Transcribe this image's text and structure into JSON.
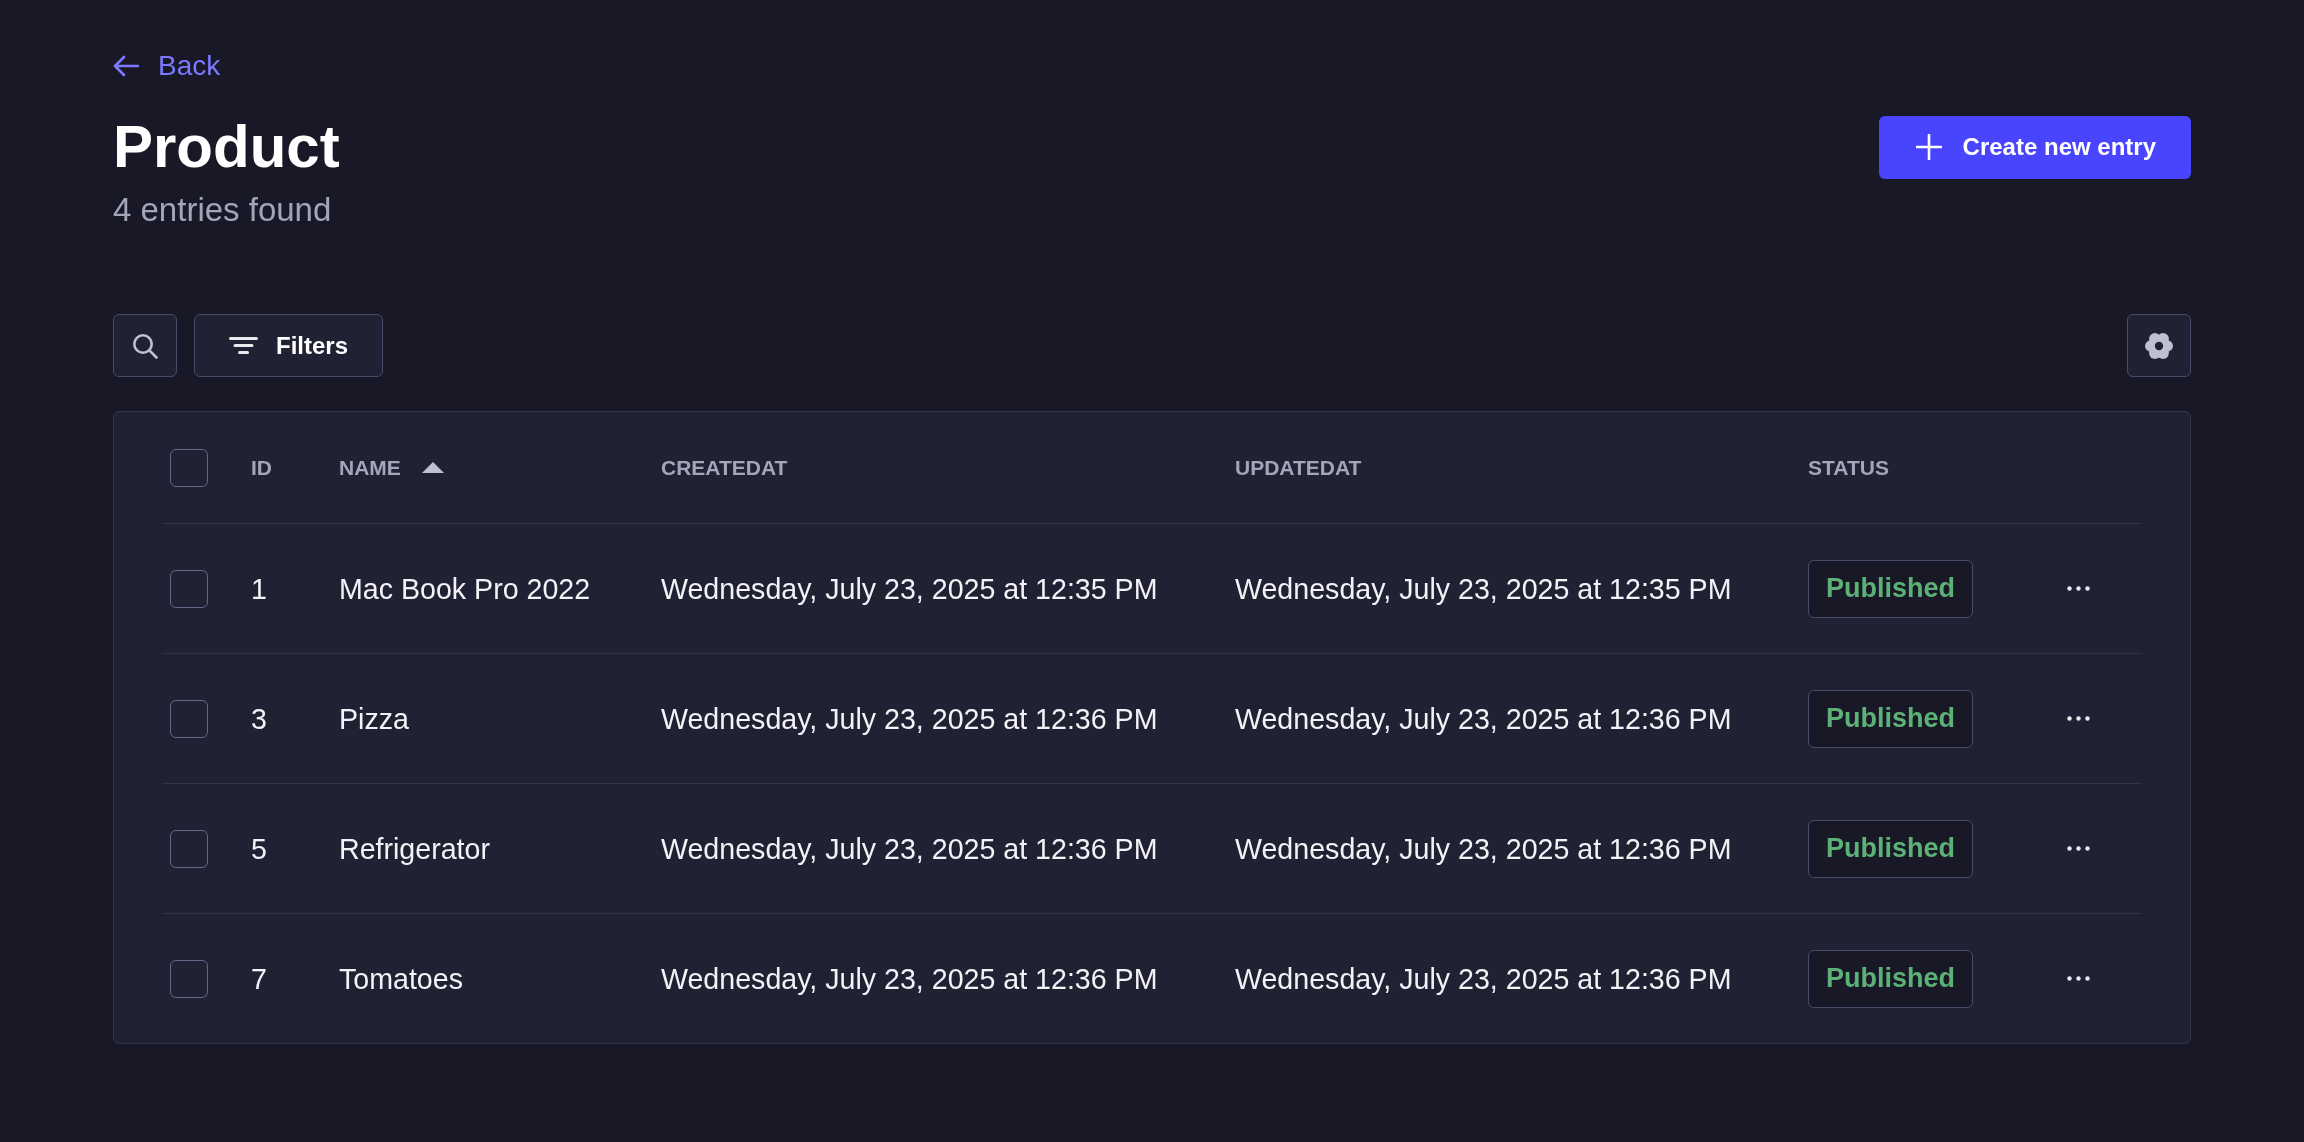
{
  "back_link": {
    "label": "Back"
  },
  "header": {
    "title": "Product",
    "subtitle": "4 entries found",
    "create_button": {
      "label": "Create new entry"
    }
  },
  "toolbar": {
    "filters_button": {
      "label": "Filters"
    }
  },
  "table": {
    "select_all": {
      "checked": false
    },
    "columns": [
      {
        "label": "ID",
        "sorted": false
      },
      {
        "label": "NAME",
        "sorted": true
      },
      {
        "label": "CREATEDAT",
        "sorted": false
      },
      {
        "label": "UPDATEDAT",
        "sorted": false
      },
      {
        "label": "STATUS",
        "sorted": false
      }
    ],
    "rows": [
      {
        "checked": false,
        "id": "1",
        "name": "Mac Book Pro 2022",
        "createdat": "Wednesday, July 23, 2025 at 12:35 PM",
        "updatedat": "Wednesday, July 23, 2025 at 12:35 PM",
        "status": {
          "label": "Published",
          "kind": "published"
        }
      },
      {
        "checked": false,
        "id": "3",
        "name": "Pizza",
        "createdat": "Wednesday, July 23, 2025 at 12:36 PM",
        "updatedat": "Wednesday, July 23, 2025 at 12:36 PM",
        "status": {
          "label": "Published",
          "kind": "published"
        }
      },
      {
        "checked": false,
        "id": "5",
        "name": "Refrigerator",
        "createdat": "Wednesday, July 23, 2025 at 12:36 PM",
        "updatedat": "Wednesday, July 23, 2025 at 12:36 PM",
        "status": {
          "label": "Published",
          "kind": "published"
        }
      },
      {
        "checked": false,
        "id": "7",
        "name": "Tomatoes",
        "createdat": "Wednesday, July 23, 2025 at 12:36 PM",
        "updatedat": "Wednesday, July 23, 2025 at 12:36 PM",
        "status": {
          "label": "Published",
          "kind": "published"
        }
      }
    ]
  }
}
